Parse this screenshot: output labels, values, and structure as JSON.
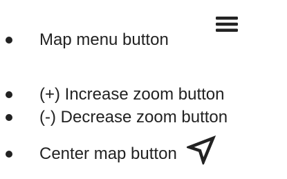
{
  "items": [
    {
      "label": "Map menu button",
      "icon": "hamburger-menu-icon"
    },
    {
      "label": "(+) Increase zoom button",
      "icon": null
    },
    {
      "label": "(-) Decrease zoom button",
      "icon": null
    },
    {
      "label": "Center map button",
      "icon": "navigation-arrow-icon"
    }
  ],
  "colors": {
    "text": "#222222",
    "background": "#ffffff"
  }
}
